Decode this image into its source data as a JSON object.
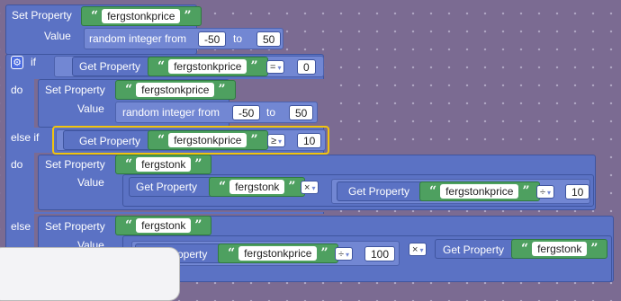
{
  "labels": {
    "set_property": "Set Property",
    "get_property": "Get Property",
    "value": "Value",
    "random_integer_from": "random integer from",
    "to": "to",
    "if": "if",
    "do": "do",
    "else_if": "else if",
    "else": "else",
    "get_property_partial": "operty"
  },
  "strings": {
    "price": "fergstonkprice",
    "stonk": "fergstonk"
  },
  "numbers": {
    "rand1_from": "-50",
    "rand1_to": "50",
    "if_compare": "0",
    "rand2_from": "-50",
    "rand2_to": "50",
    "elseif_compare": "10",
    "div_a": "10",
    "div_b": "100"
  },
  "operators": {
    "eq": "=",
    "gte": "≥",
    "times": "×",
    "divide": "÷"
  },
  "icons": {
    "gear": "⚙",
    "caret": "▾",
    "open_quote": "“",
    "close_quote": "”"
  }
}
